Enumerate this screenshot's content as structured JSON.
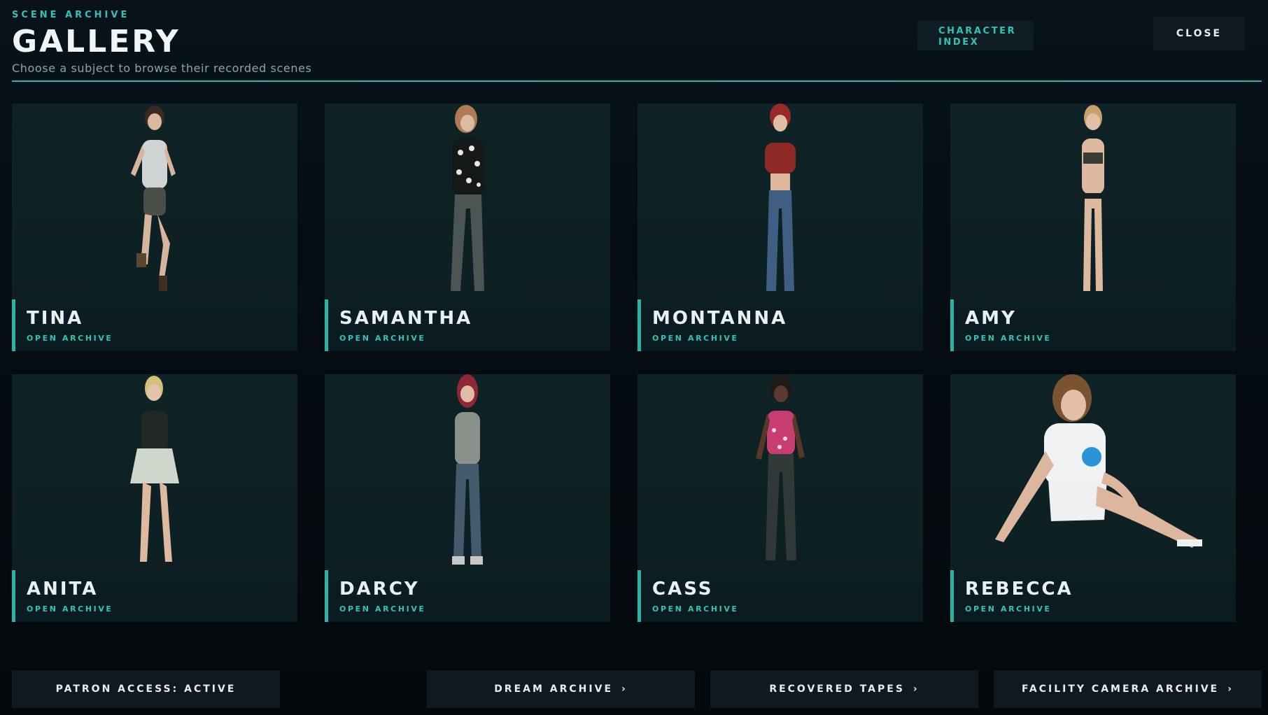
{
  "header": {
    "eyebrow": "SCENE ARCHIVE",
    "title": "GALLERY",
    "subtitle": "Choose a subject to browse their recorded scenes",
    "index_label_line1": "CHARACTER",
    "index_label_line2": "INDEX",
    "close_label": "CLOSE"
  },
  "cards": [
    {
      "name": "TINA",
      "link": "OPEN ARCHIVE"
    },
    {
      "name": "SAMANTHA",
      "link": "OPEN ARCHIVE"
    },
    {
      "name": "MONTANNA",
      "link": "OPEN ARCHIVE"
    },
    {
      "name": "AMY",
      "link": "OPEN ARCHIVE"
    },
    {
      "name": "ANITA",
      "link": "OPEN ARCHIVE"
    },
    {
      "name": "DARCY",
      "link": "OPEN ARCHIVE"
    },
    {
      "name": "CASS",
      "link": "OPEN ARCHIVE"
    },
    {
      "name": "REBECCA",
      "link": "OPEN ARCHIVE"
    }
  ],
  "footer": {
    "patron": "PATRON ACCESS: ACTIVE",
    "dream": "DREAM ARCHIVE",
    "tapes": "RECOVERED TAPES",
    "camera": "FACILITY CAMERA ARCHIVE",
    "chevron": "›"
  },
  "colors": {
    "accent": "#2ab3a6",
    "background": "#050b10",
    "card": "#0f2327",
    "button": "#101820"
  }
}
